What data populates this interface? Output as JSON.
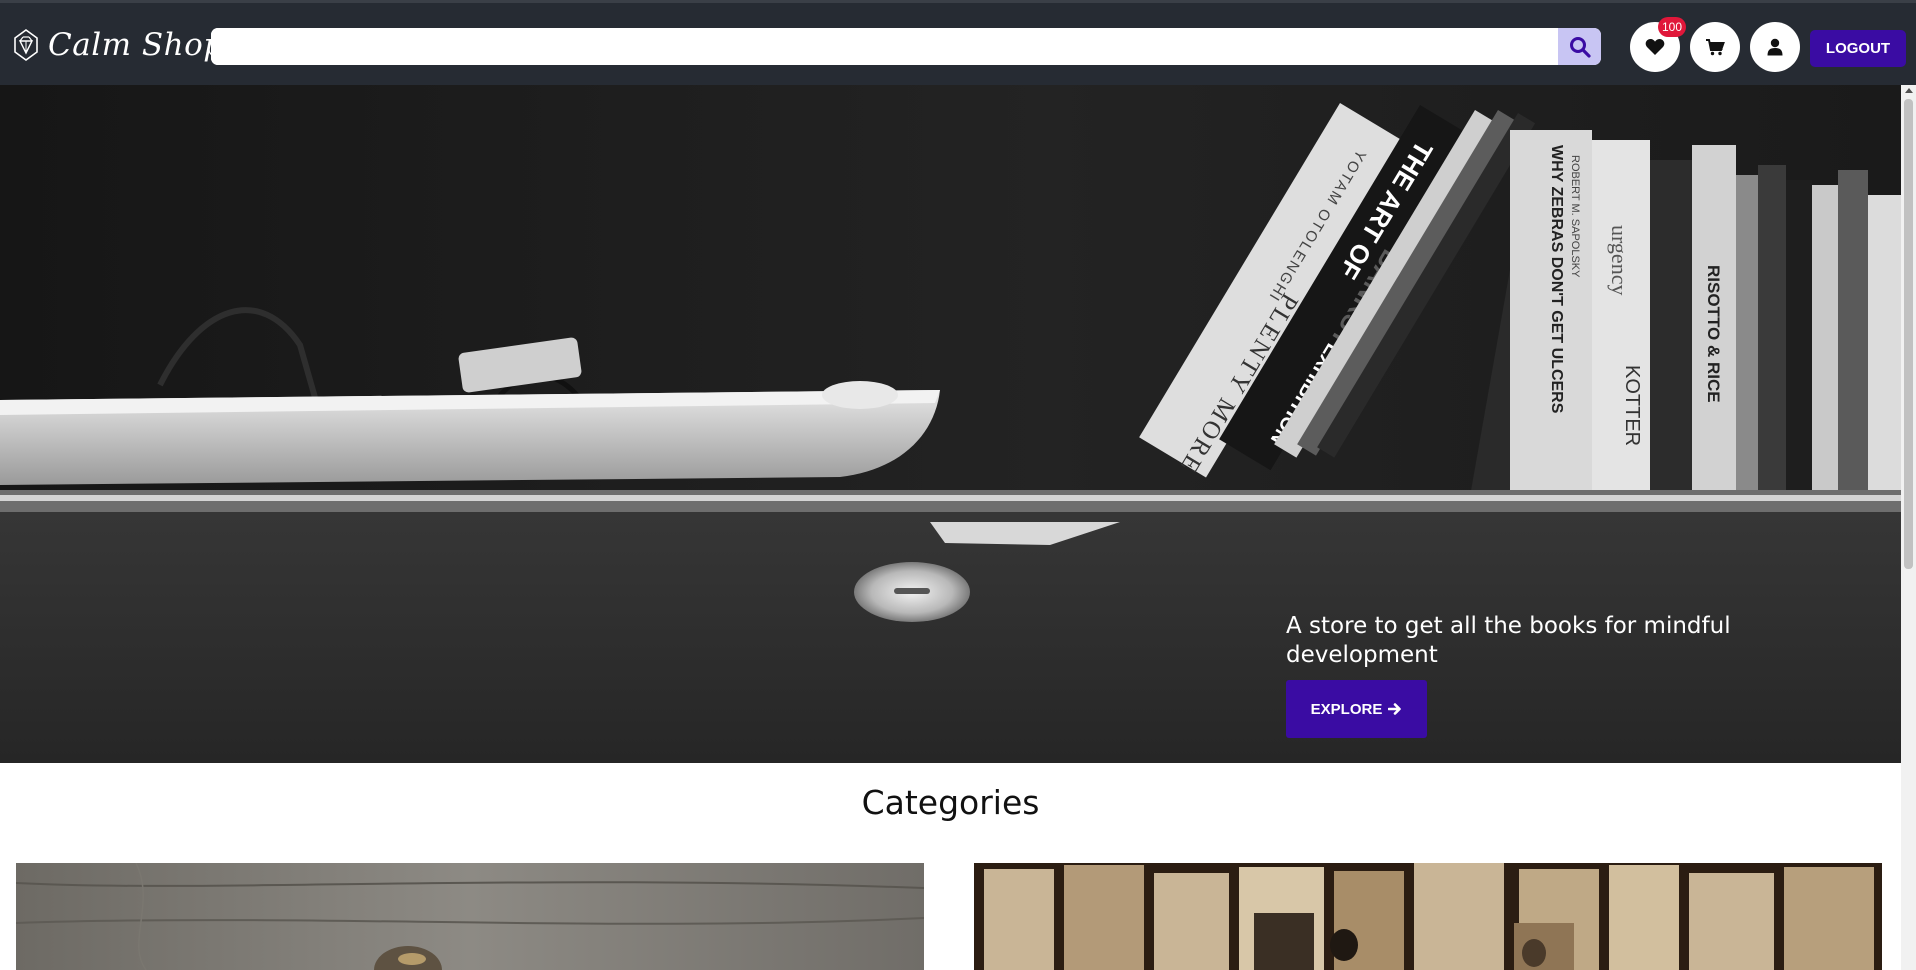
{
  "header": {
    "logo_text": "Calm Shop",
    "search_placeholder": "",
    "wishlist_count": "100",
    "logout_label": "LOGOUT"
  },
  "hero": {
    "tagline": "A store to get all the books for mindful development",
    "explore_label": "EXPLORE",
    "book_spines": {
      "otolenghi": "YOTAM OTOLENGHI",
      "plenty_more": "PLENTY MORE",
      "art_of": "THE ART OF",
      "banksy": "BANKSY",
      "exhibition": "EXHIBITION",
      "zebras": "WHY ZEBRAS DON'T GET ULCERS",
      "sapolsky": "ROBERT M. SAPOLSKY",
      "urgency": "urgency",
      "kotter": "KOTTER",
      "risotto": "RISOTTO & RICE"
    }
  },
  "categories": {
    "title": "Categories"
  },
  "colors": {
    "navbar": "#262b33",
    "accent": "#3a0ca3",
    "badge": "#e0173a",
    "search_button": "#c8c5f3"
  },
  "icons": {
    "logo": "diamond-icon",
    "search": "search-icon",
    "wishlist": "heart-icon",
    "cart": "cart-icon",
    "account": "user-icon",
    "explore": "arrow-right-icon"
  }
}
